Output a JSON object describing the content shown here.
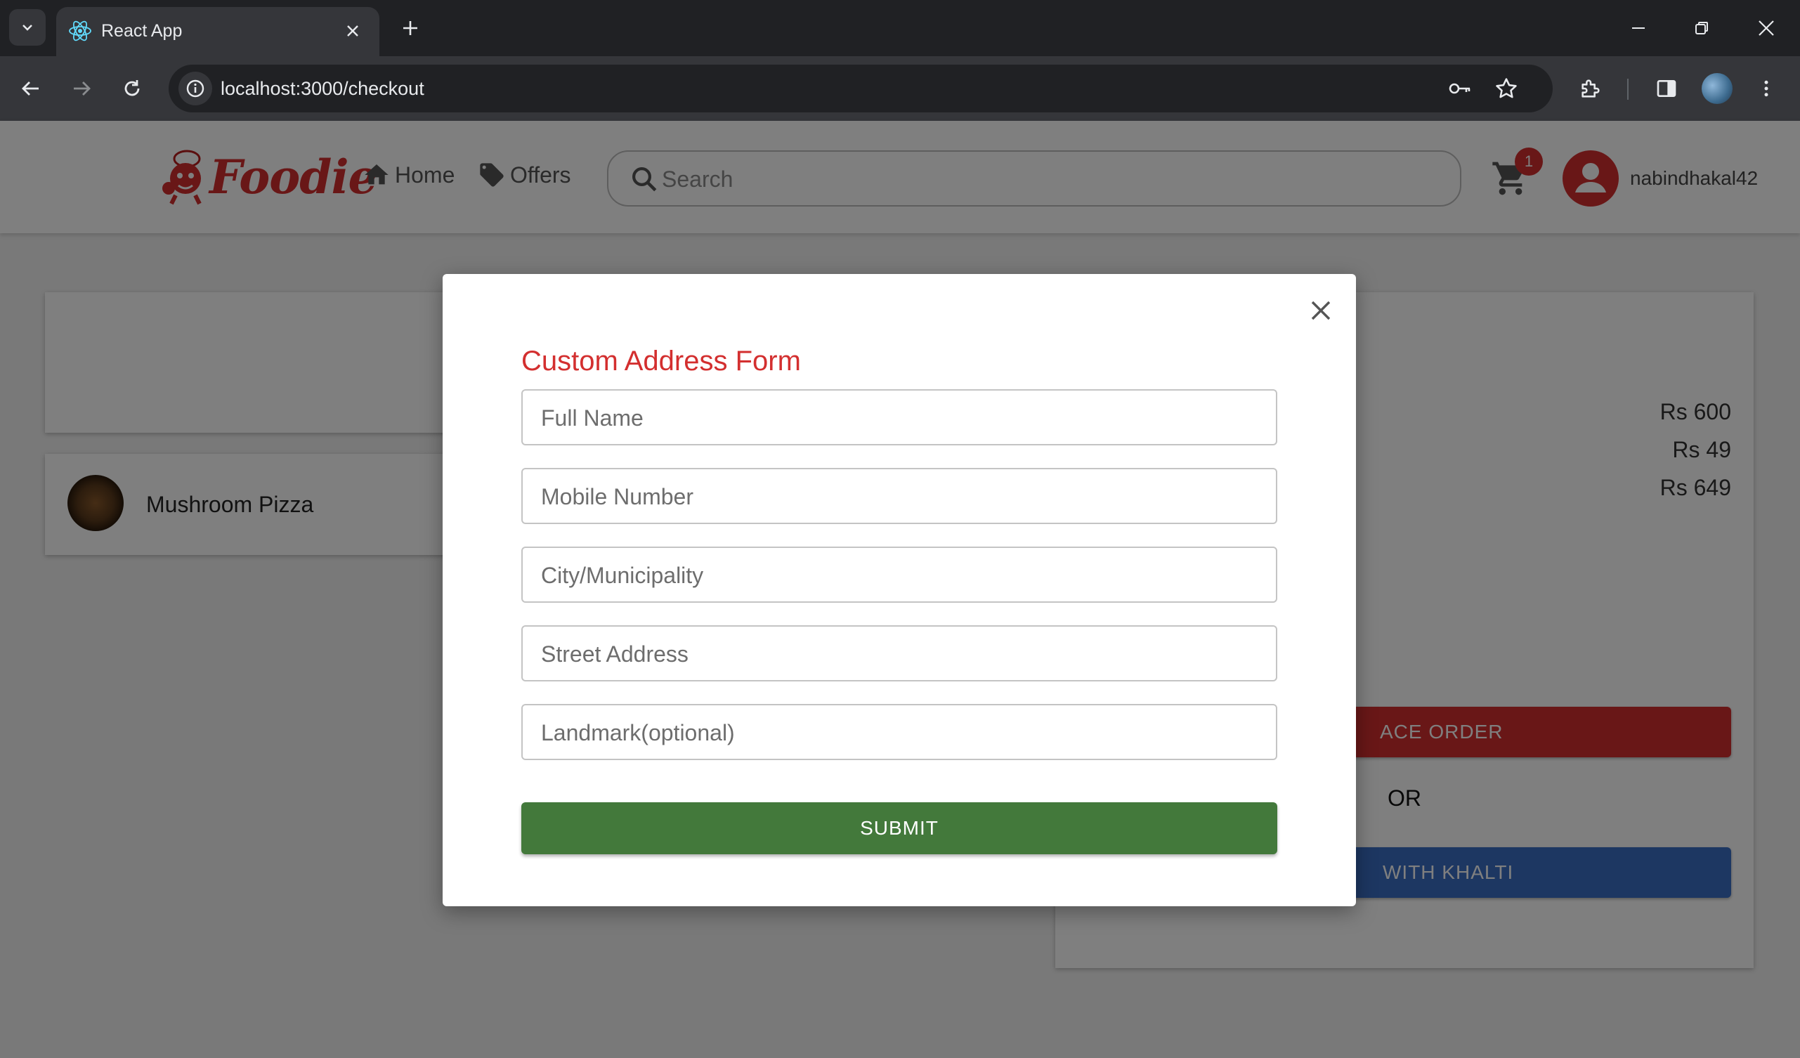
{
  "browser": {
    "tab_title": "React App",
    "url": "localhost:3000/checkout",
    "icons": [
      "tab-search-icon",
      "react-icon",
      "close-icon",
      "plus-icon",
      "minimize-icon",
      "restore-icon",
      "close-window-icon",
      "back-arrow-icon",
      "forward-arrow-icon",
      "reload-icon",
      "site-info-icon",
      "key-icon",
      "star-icon",
      "extensions-icon",
      "side-panel-icon",
      "profile-icon",
      "more-vert-icon"
    ]
  },
  "header": {
    "brand": "Foodie",
    "nav": {
      "home": "Home",
      "offers": "Offers"
    },
    "search": {
      "placeholder": "Search",
      "value": ""
    },
    "cart_count": "1",
    "username": "nabindhakal42",
    "colors": {
      "brand": "#d32f2f"
    }
  },
  "checkout": {
    "items": [
      {
        "name": "Mushroom Pizza"
      }
    ],
    "prices": {
      "subtotal": "Rs 600",
      "delivery": "Rs 49",
      "total": "Rs 649"
    },
    "place_order_label": "ACE ORDER",
    "or_label": "OR",
    "khalti_label": "WITH KHALTI",
    "colors": {
      "place_order": "#d32f2f",
      "khalti": "#3a6fc4"
    }
  },
  "modal": {
    "title": "Custom Address Form",
    "fields": [
      {
        "placeholder": "Full Name",
        "value": ""
      },
      {
        "placeholder": "Mobile Number",
        "value": ""
      },
      {
        "placeholder": "City/Municipality",
        "value": ""
      },
      {
        "placeholder": "Street Address",
        "value": ""
      },
      {
        "placeholder": "Landmark(optional)",
        "value": ""
      }
    ],
    "submit_label": "SUBMIT",
    "colors": {
      "title": "#d32f2f",
      "submit": "#43793b"
    }
  }
}
